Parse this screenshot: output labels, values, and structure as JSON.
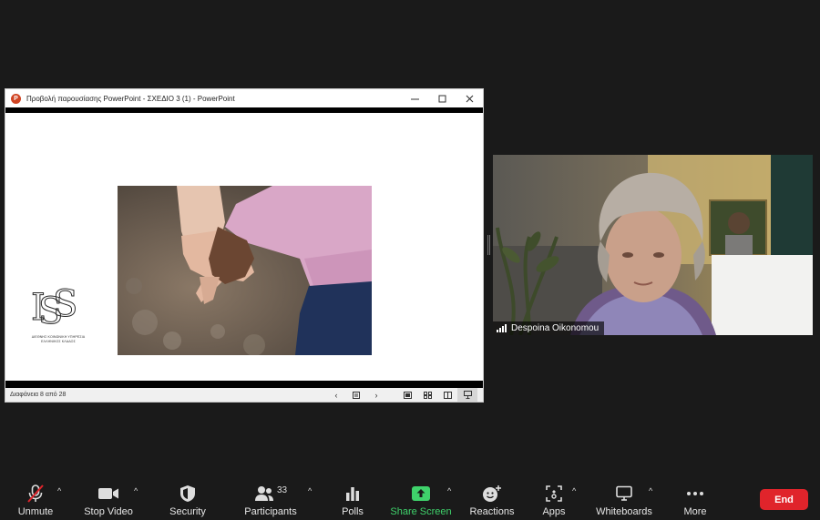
{
  "ppt": {
    "title": "Προβολή παρουσίασης PowerPoint  -  ΣΧΕΔΙΟ 3 (1) - PowerPoint",
    "app_icon_letter": "P",
    "status": "Διαφάνεια 8 από 28",
    "logo_caption_line1": "ΔΙΕΘΝΗΣ ΚΟΙΝΩΝΙΚΗ ΥΠΗΡΕΣΙΑ",
    "logo_caption_line2": "ΕΛΛΗΝΙΚΟΣ ΚΛΑΔΟΣ"
  },
  "video": {
    "participant_name": "Despoina Oikonomou"
  },
  "toolbar": {
    "unmute": "Unmute",
    "stop_video": "Stop Video",
    "security": "Security",
    "participants": "Participants",
    "participants_count": "33",
    "polls": "Polls",
    "share_screen": "Share Screen",
    "reactions": "Reactions",
    "apps": "Apps",
    "whiteboards": "Whiteboards",
    "more": "More",
    "end": "End"
  },
  "colors": {
    "share_green": "#3fd26b",
    "end_red": "#e0242b",
    "ppt_orange": "#d04423"
  }
}
